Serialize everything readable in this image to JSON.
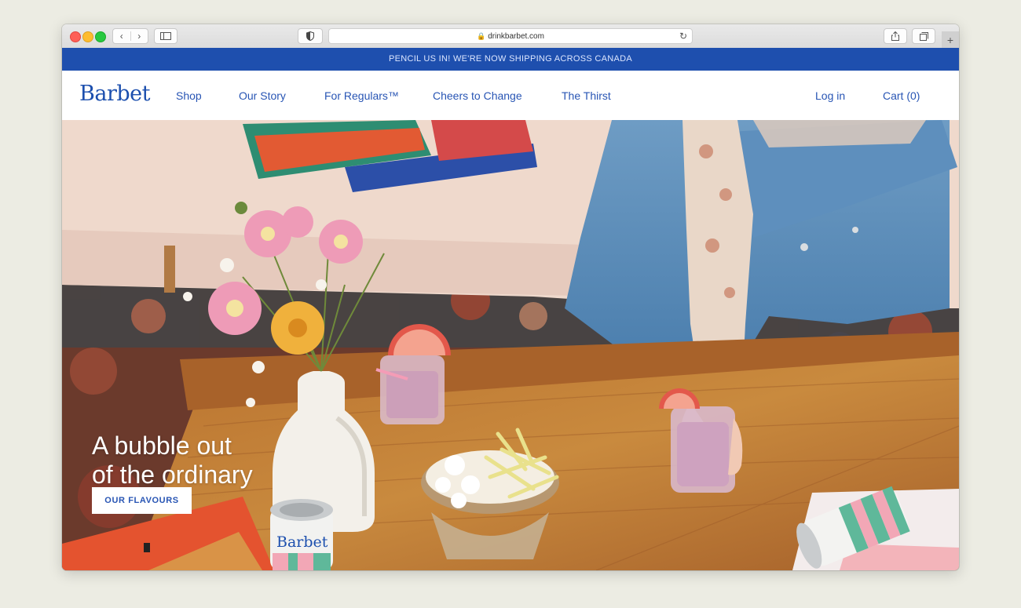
{
  "browser": {
    "url": "drinkbarbet.com",
    "back_icon": "‹",
    "forward_icon": "›",
    "reload_icon": "↻",
    "new_tab_icon": "+"
  },
  "announcement": "PENCIL US IN! WE'RE NOW SHIPPING ACROSS CANADA",
  "nav": {
    "logo": "Barbet",
    "links": [
      "Shop",
      "Our Story",
      "For Regulars™",
      "Cheers to Change",
      "The Thirst"
    ],
    "login": "Log in",
    "cart": "Cart (0)"
  },
  "hero": {
    "headline_line1": "A bubble out",
    "headline_line2": "of the ordinary",
    "cta": "OUR FLAVOURS",
    "can_text": "Barbet"
  },
  "colors": {
    "brand_blue": "#1e4fae",
    "link_blue": "#2855b4",
    "table_wood": "#c07a35"
  }
}
